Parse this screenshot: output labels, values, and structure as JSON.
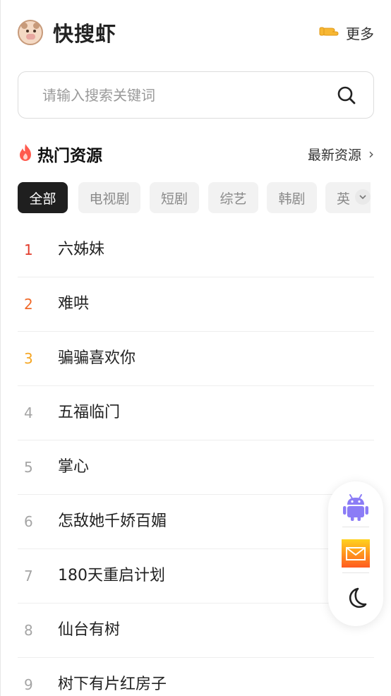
{
  "header": {
    "brand_name": "快搜虾",
    "more_label": "更多",
    "more_icon": "pointing-hand-icon"
  },
  "search": {
    "placeholder": "请输入搜索关键词",
    "icon": "search-icon"
  },
  "section": {
    "title": "热门资源",
    "title_icon": "fire-icon",
    "latest_label": "最新资源",
    "latest_icon": "chevron-right-icon"
  },
  "tabs": [
    "全部",
    "电视剧",
    "短剧",
    "综艺",
    "韩剧",
    "英"
  ],
  "active_tab": "全部",
  "list": [
    {
      "rank": "1",
      "title": "六姊妹"
    },
    {
      "rank": "2",
      "title": "难哄"
    },
    {
      "rank": "3",
      "title": "骗骗喜欢你"
    },
    {
      "rank": "4",
      "title": "五福临门"
    },
    {
      "rank": "5",
      "title": "掌心"
    },
    {
      "rank": "6",
      "title": "怎敌她千娇百媚"
    },
    {
      "rank": "7",
      "title": "180天重启计划"
    },
    {
      "rank": "8",
      "title": "仙台有树"
    },
    {
      "rank": "9",
      "title": "树下有片红房子"
    }
  ],
  "float_panel": {
    "items": [
      "android-icon",
      "mail-icon",
      "moon-icon"
    ]
  },
  "colors": {
    "rank1": "#e23b2b",
    "rank2": "#f06a2a",
    "rank3": "#f5a623",
    "active_tab_bg": "#1f1f1f",
    "android": "#8b7cf6"
  }
}
